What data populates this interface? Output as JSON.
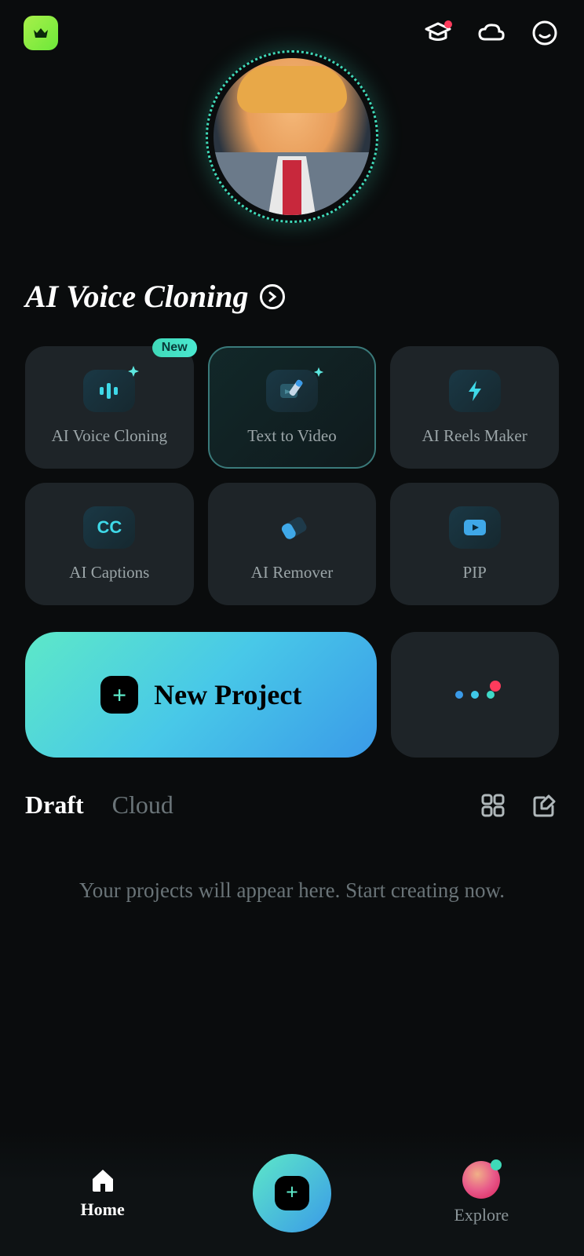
{
  "header": {
    "crown_icon": "crown"
  },
  "section": {
    "title": "AI Voice Cloning"
  },
  "features": [
    {
      "label": "AI Voice Cloning",
      "badge": "New"
    },
    {
      "label": "Text to Video"
    },
    {
      "label": "AI Reels Maker"
    },
    {
      "label": "AI Captions"
    },
    {
      "label": "AI Remover"
    },
    {
      "label": "PIP"
    }
  ],
  "new_project": {
    "label": "New Project"
  },
  "tabs": {
    "draft": "Draft",
    "cloud": "Cloud"
  },
  "empty_state": "Your projects will appear here. Start creating now.",
  "nav": {
    "home": "Home",
    "explore": "Explore"
  },
  "colors": {
    "accent_teal": "#3fd9b8",
    "accent_blue": "#3a9ae8"
  },
  "cc_text": "CC"
}
